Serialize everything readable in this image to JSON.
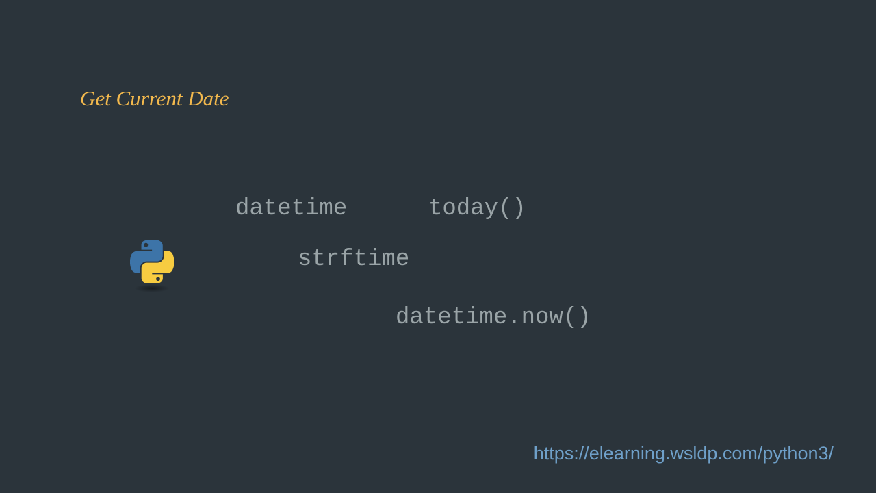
{
  "title": "Get Current Date",
  "keywords": {
    "k1": "datetime",
    "k2": "today()",
    "k3": "strftime",
    "k4": "datetime.now()"
  },
  "footer": {
    "url": "https://elearning.wsldp.com/python3/"
  },
  "icon_name": "python-logo"
}
